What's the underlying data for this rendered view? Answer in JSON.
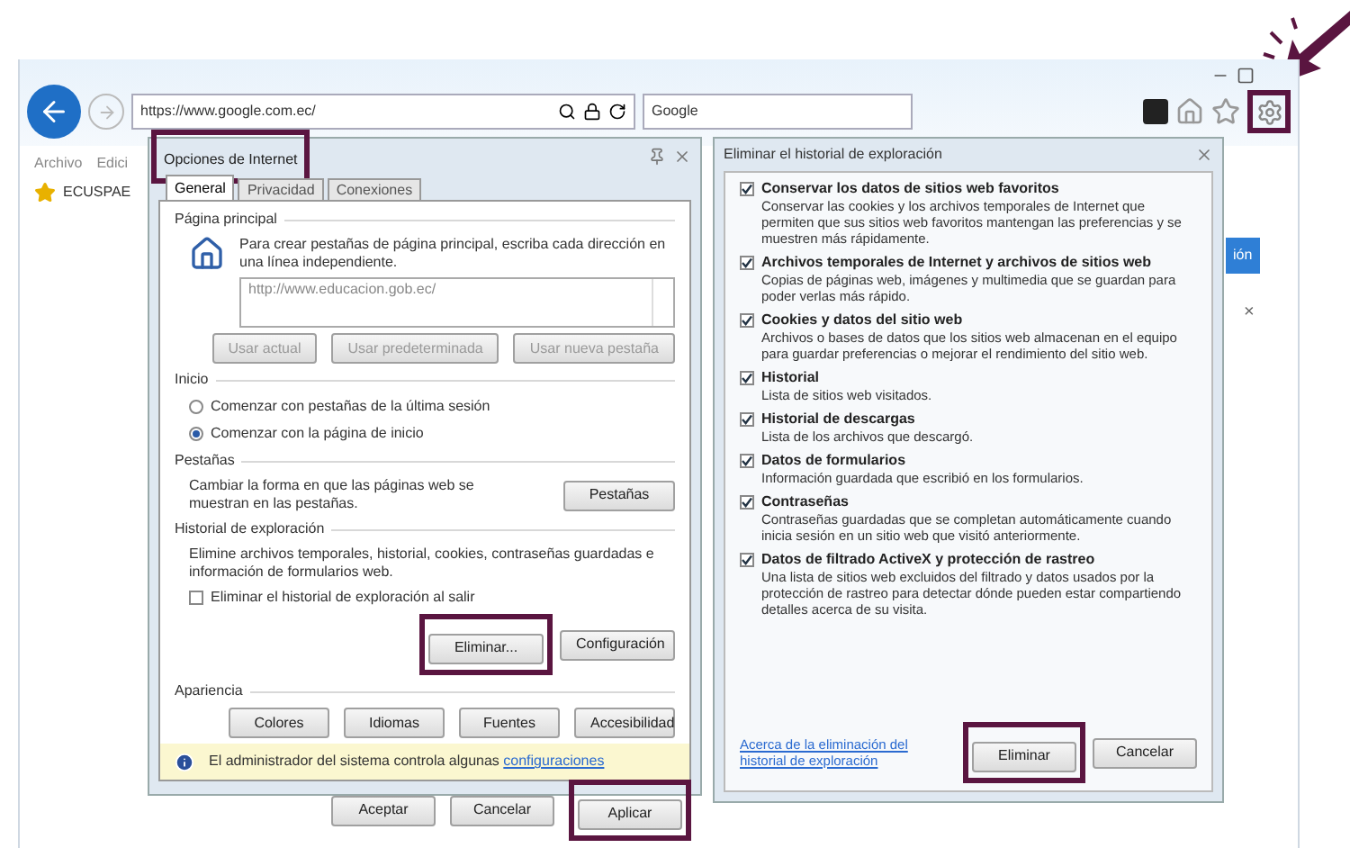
{
  "browser": {
    "address": "https://www.google.com.ec/",
    "search": "Google",
    "menu": [
      "Archivo",
      "Edici"
    ],
    "favorite": "ECUSPAE",
    "settings_highlighted": true
  },
  "side_content": {
    "button": "ión",
    "close": "×"
  },
  "internet_options": {
    "title": "Opciones de Internet",
    "title_highlighted": true,
    "tabs": [
      {
        "label": "General",
        "selected": true
      },
      {
        "label": "Privacidad",
        "selected": false
      },
      {
        "label": "Conexiones",
        "selected": false
      }
    ],
    "home_page": {
      "heading": "Página principal",
      "text": "Para crear pestañas de página principal, escriba cada dirección en una línea independiente.",
      "url": "http://www.educacion.gob.ec/",
      "buttons": [
        {
          "label": "Usar actual",
          "disabled": true
        },
        {
          "label": "Usar predeterminada",
          "disabled": true
        },
        {
          "label": "Usar nueva pestaña",
          "disabled": true
        }
      ]
    },
    "startup": {
      "heading": "Inicio",
      "options": [
        {
          "label": "Comenzar con pestañas de la última sesión",
          "selected": false
        },
        {
          "label": "Comenzar con la página de inicio",
          "selected": true
        }
      ]
    },
    "tabs_section": {
      "heading": "Pestañas",
      "text": "Cambiar la forma en que las páginas web se muestran en las pestañas.",
      "button": "Pestañas"
    },
    "history": {
      "heading": "Historial de exploración",
      "text": "Elimine archivos temporales, historial, cookies, contraseñas guardadas e información de formularios web.",
      "checkbox": {
        "label": "Eliminar el historial de exploración al salir",
        "checked": false
      },
      "buttons": [
        {
          "label": "Eliminar...",
          "highlighted": true
        },
        {
          "label": "Configuración",
          "highlighted": false
        }
      ]
    },
    "appearance": {
      "heading": "Apariencia",
      "buttons": [
        "Colores",
        "Idiomas",
        "Fuentes",
        "Accesibilidad"
      ]
    },
    "notice": {
      "text": "El administrador del sistema controla algunas",
      "link": "configuraciones"
    },
    "footer": [
      {
        "label": "Aceptar",
        "highlighted": false
      },
      {
        "label": "Cancelar",
        "highlighted": false
      },
      {
        "label": "Aplicar",
        "highlighted": true
      }
    ]
  },
  "delete_history": {
    "title": "Eliminar el historial de exploración",
    "items": [
      {
        "label": "Conservar los datos de sitios web favoritos",
        "description": "Conservar las cookies y los archivos temporales de Internet que permiten que sus sitios web favoritos mantengan las preferencias y se muestren más rápidamente.",
        "checked": true
      },
      {
        "label": "Archivos temporales de Internet y archivos de sitios web",
        "description": "Copias de páginas web, imágenes y multimedia que se guardan para poder verlas más rápido.",
        "checked": true
      },
      {
        "label": "Cookies y datos del sitio web",
        "description": "Archivos o bases de datos que los sitios web almacenan en el equipo para guardar preferencias o mejorar el rendimiento del sitio web.",
        "checked": true
      },
      {
        "label": "Historial",
        "description": "Lista de sitios web visitados.",
        "checked": true
      },
      {
        "label": "Historial de descargas",
        "description": "Lista de los archivos que descargó.",
        "checked": true
      },
      {
        "label": "Datos de formularios",
        "description": "Información guardada que escribió en los formularios.",
        "checked": true
      },
      {
        "label": "Contraseñas",
        "description": "Contraseñas guardadas que se completan automáticamente cuando inicia sesión en un sitio web que visitó anteriormente.",
        "checked": true
      },
      {
        "label": "Datos de filtrado ActiveX y protección de rastreo",
        "description": "Una lista de sitios web excluidos del filtrado y datos usados por la protección de rastreo para detectar dónde pueden estar compartiendo detalles acerca de su visita.",
        "checked": true
      }
    ],
    "link": "Acerca de la eliminación del historial de exploración",
    "buttons": [
      {
        "label": "Eliminar",
        "highlighted": true
      },
      {
        "label": "Cancelar",
        "highlighted": false
      }
    ]
  }
}
